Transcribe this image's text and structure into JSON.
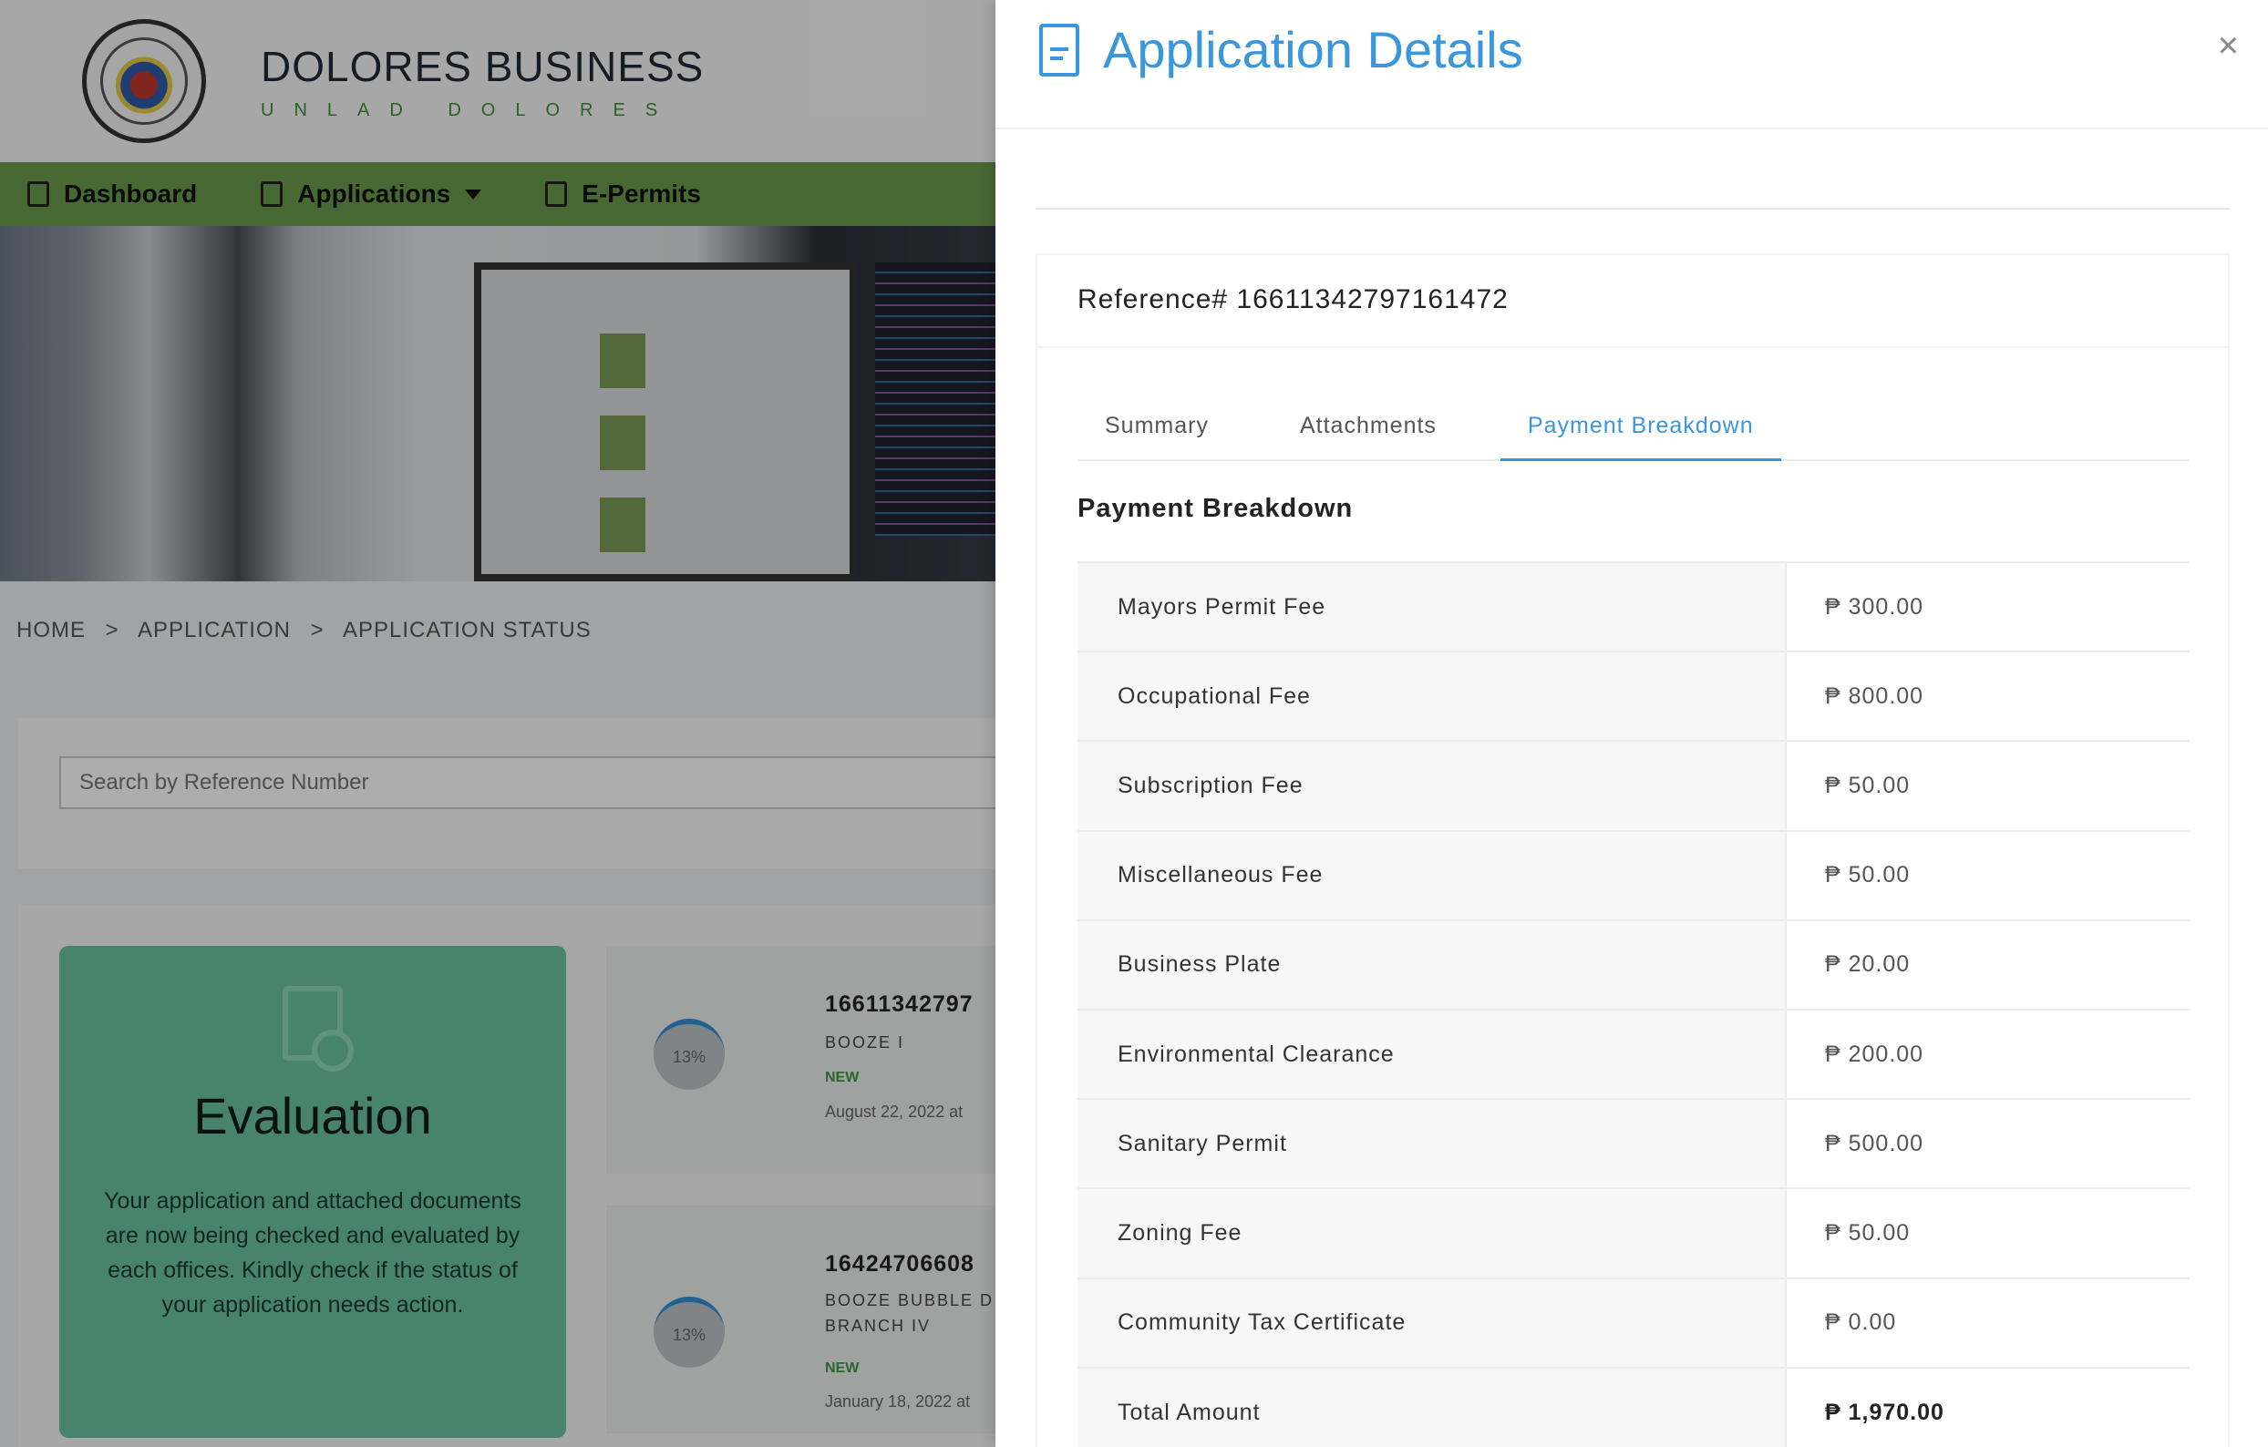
{
  "site": {
    "name": "DOLORES BUSINESS",
    "tagline": "UNLAD DOLORES"
  },
  "nav": {
    "items": [
      {
        "label": "Dashboard",
        "icon": "dashboard-icon"
      },
      {
        "label": "Applications",
        "icon": "edit-icon"
      },
      {
        "label": "E-Permits",
        "icon": "permit-icon"
      }
    ]
  },
  "breadcrumb": [
    "HOME",
    ">",
    "APPLICATION",
    ">",
    "APPLICATION STATUS"
  ],
  "search": {
    "placeholder": "Search by Reference Number"
  },
  "evaluation": {
    "title": "Evaluation",
    "text": "Your application and attached documents are now being checked and evaluated by each offices. Kindly check if the status of your application needs action."
  },
  "applications": [
    {
      "reference": "16611342797",
      "business": "BOOZE I",
      "status": "NEW",
      "date": "August 22, 2022 at",
      "progress": "13%"
    },
    {
      "reference": "16424706608",
      "business": "BOOZE BUBBLE D BRANCH IV",
      "status": "NEW",
      "date": "January 18, 2022 at",
      "progress": "13%"
    }
  ],
  "modal": {
    "title": "Application Details",
    "close": "×",
    "reference_label": "Reference# 16611342797161472",
    "tabs": [
      "Summary",
      "Attachments",
      "Payment Breakdown"
    ],
    "active_tab": "Payment Breakdown",
    "section_title": "Payment Breakdown",
    "fees": [
      {
        "name": "Mayors Permit Fee",
        "amount": "₱ 300.00"
      },
      {
        "name": "Occupational Fee",
        "amount": "₱ 800.00"
      },
      {
        "name": "Subscription Fee",
        "amount": "₱ 50.00"
      },
      {
        "name": "Miscellaneous Fee",
        "amount": "₱ 50.00"
      },
      {
        "name": "Business Plate",
        "amount": "₱ 20.00"
      },
      {
        "name": "Environmental Clearance",
        "amount": "₱ 200.00"
      },
      {
        "name": "Sanitary Permit",
        "amount": "₱ 500.00"
      },
      {
        "name": "Zoning Fee",
        "amount": "₱ 50.00"
      },
      {
        "name": "Community Tax Certificate",
        "amount": "₱ 0.00"
      },
      {
        "name": "Total Amount",
        "amount": "₱ 1,970.00"
      }
    ]
  },
  "colors": {
    "accent": "#3a96dd",
    "nav_green": "#6a9b4c",
    "evaluation": "#6bc2a3"
  }
}
